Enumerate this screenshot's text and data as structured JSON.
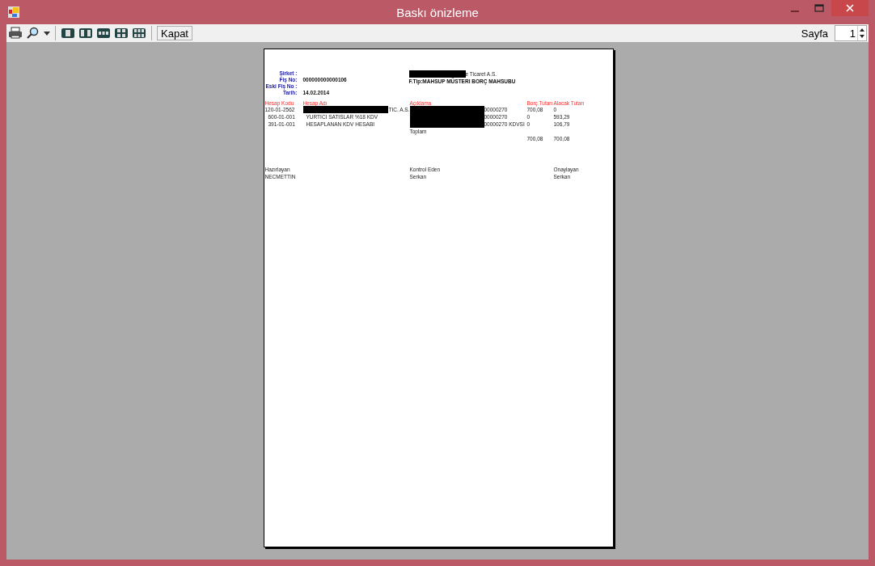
{
  "window": {
    "title": "Baskı önizleme"
  },
  "toolbar": {
    "close_button": "Kapat",
    "page_label": "Sayfa",
    "page_value": "1"
  },
  "document": {
    "header_left": [
      {
        "label": "Şirket :"
      },
      {
        "label": "Fiş No:",
        "value": "000000000000106"
      },
      {
        "label": "Eski Fiş No :"
      },
      {
        "label": "Tarih:",
        "value": "14.02.2014"
      }
    ],
    "company": {
      "text": "e Ticaret A.S.",
      "redacted": true
    },
    "fis_tipi": "F.Tip:MAHSUP    MÜSTERI BORÇ MAHSUBU",
    "columns": [
      "Hesap Kodu",
      "Hesap Adı",
      "Açıklama",
      "Borç Tutarı",
      "Alacak Tutarı"
    ],
    "rows": [
      {
        "code": "120-01-2562",
        "name": "TIC. A.S.",
        "name_redacted": true,
        "description": "00000270",
        "description_redacted": true,
        "debit": "700,08",
        "credit": "0"
      },
      {
        "code": "600-01-001",
        "name": "YURTICI SATISLAR %18 KDV",
        "name_redacted": false,
        "description": "00000270",
        "description_redacted": true,
        "debit": "0",
        "credit": "593,29"
      },
      {
        "code": "391-01-001",
        "name": "HESAPLANAN KDV HESABI",
        "name_redacted": false,
        "description": "00000270 KDVSI",
        "description_redacted": true,
        "debit": "0",
        "credit": "106,79"
      }
    ],
    "totals": {
      "label": "Toplam",
      "debit": "700,08",
      "credit": "700,08"
    },
    "signatures": [
      {
        "role": "Hazırlayan",
        "name": "NECMETTIN"
      },
      {
        "role": "Kontrol Eden",
        "name": "Serkan"
      },
      {
        "role": "Onaylayan",
        "name": "Serkan"
      }
    ]
  }
}
